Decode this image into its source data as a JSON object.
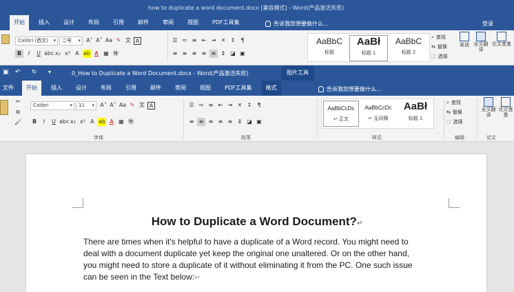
{
  "back_window": {
    "title": "how to duplicate a word document.docx [兼容模式] - Word(产品激活失败)",
    "tabs": [
      "开始",
      "插入",
      "设计",
      "布局",
      "引用",
      "邮件",
      "审阅",
      "视图",
      "PDF工具集"
    ],
    "active_tab_index": 0,
    "tell_me": "告诉我您想要做什么...",
    "login": "登录",
    "font_name": "Calibri (西文)",
    "font_size": "二号",
    "styles": [
      {
        "sample": "AaBbC",
        "name": "标题"
      },
      {
        "sample": "AaBł",
        "name": "标题 1"
      },
      {
        "sample": "AaBbC",
        "name": "标题 2"
      }
    ],
    "right_items": [
      "查找",
      "替换",
      "选择"
    ],
    "right_big": [
      "发送",
      "全文翻译",
      "论文查重"
    ]
  },
  "front_window": {
    "title": "0_How to Duplicate a Word Document.docx - Word(产品激活失败)",
    "picture_tools": "图片工具",
    "file_tab": "文件",
    "tabs": [
      "开始",
      "插入",
      "设计",
      "布局",
      "引用",
      "邮件",
      "审阅",
      "视图",
      "PDF工具集",
      "格式"
    ],
    "active_tab_index": 0,
    "tell_me": "告诉我您想要做什么...",
    "font_name": "Calibri",
    "font_size": "11",
    "group_labels": {
      "font": "字体",
      "paragraph": "段落",
      "styles": "样式",
      "editing": "编辑",
      "paper": "论文"
    },
    "styles": [
      {
        "sample": "AaBbCcDc",
        "name": "↵ 正文"
      },
      {
        "sample": "AaBbCcDc",
        "name": "↵ 无间隔"
      },
      {
        "sample": "AaBł",
        "name": "标题 1"
      }
    ],
    "right_items": [
      "查找",
      "替换",
      "选择"
    ],
    "right_big": [
      "全文翻译",
      "论文查重"
    ]
  },
  "document": {
    "heading": "How to Duplicate a Word Document?",
    "body_lines": [
      "There are times when it's helpful to have a duplicate of a Word record. You might need to",
      "deal with a document duplicate yet keep the original one unaltered. Or on the other hand,",
      "you might need to store a duplicate of it without eliminating it from the PC. One such issue",
      "can be seen in the Text below:"
    ]
  },
  "colors": {
    "word_blue": "#2b579a",
    "ribbon_bg": "#f3f3f3",
    "doc_bg": "#e6e6e6"
  }
}
